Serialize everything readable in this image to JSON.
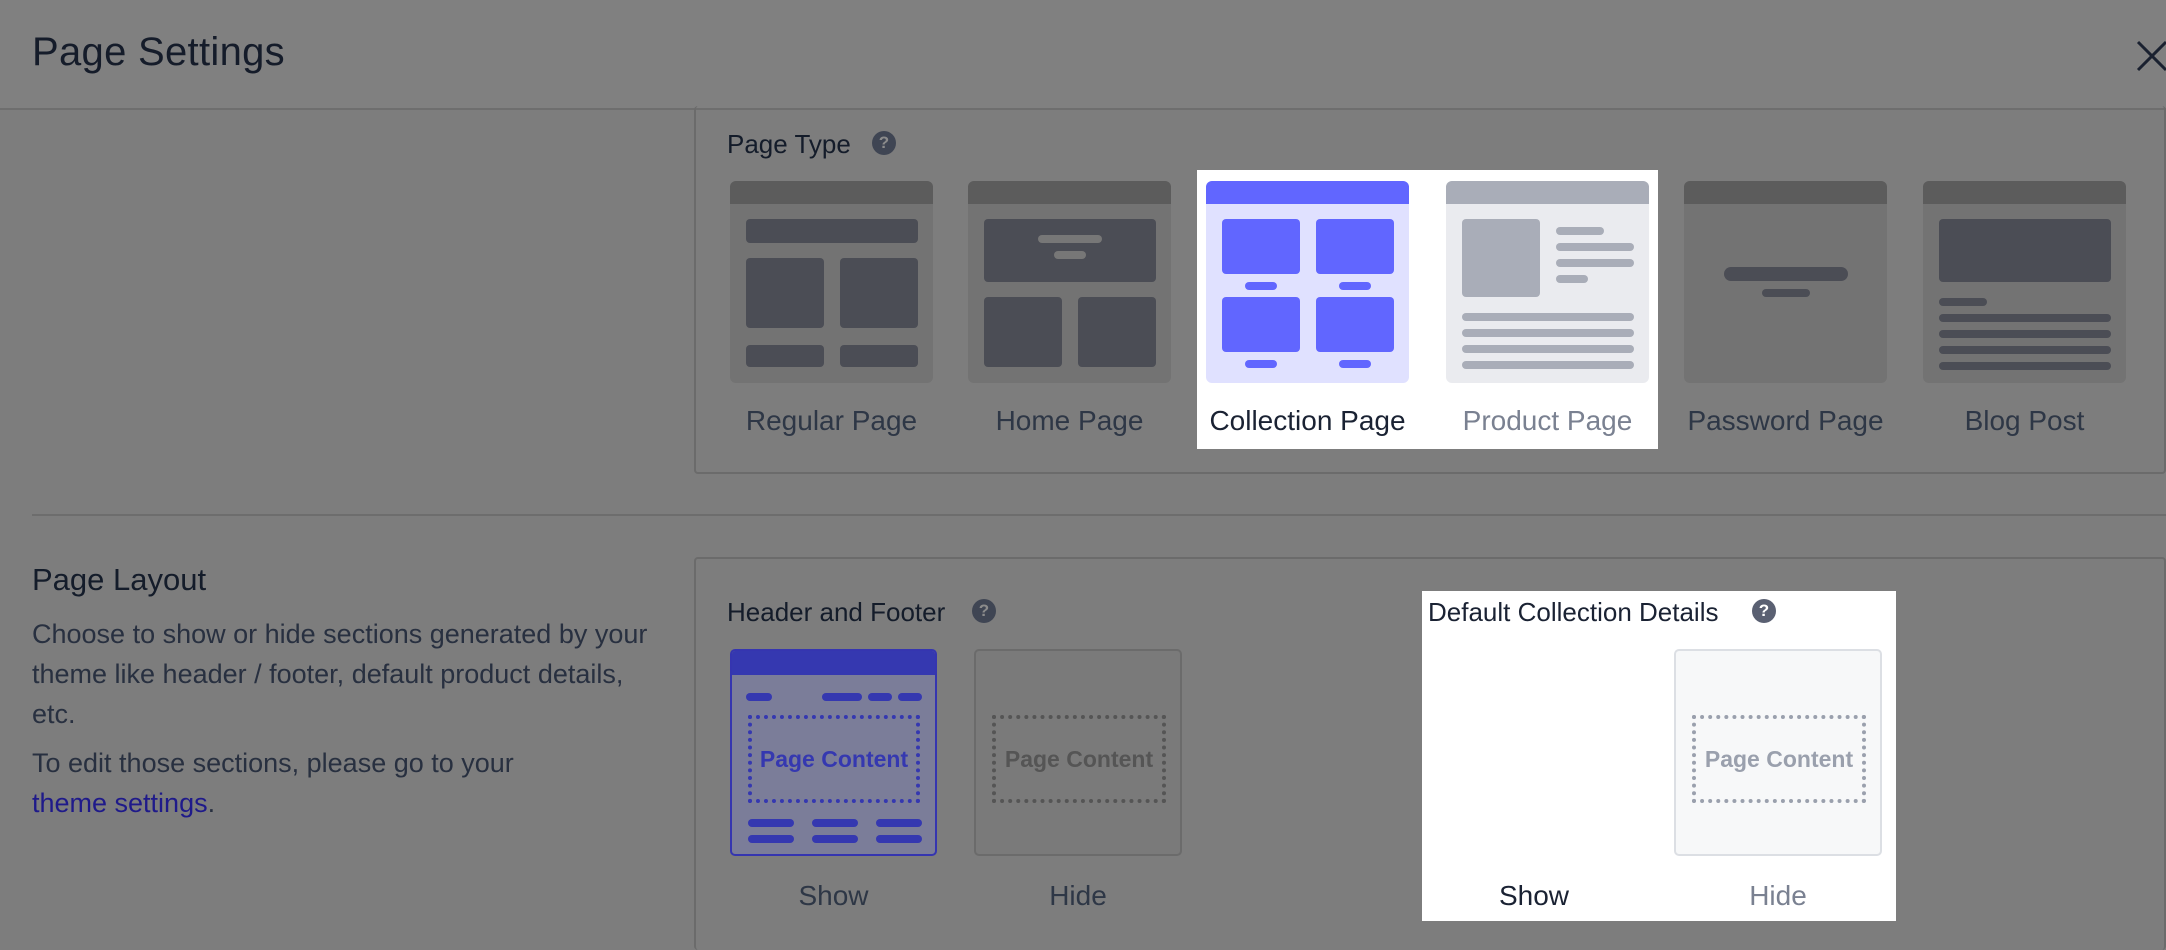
{
  "header": {
    "title": "Page Settings"
  },
  "page_type": {
    "label": "Page Type",
    "help": "?",
    "cards": [
      {
        "label": "Regular Page"
      },
      {
        "label": "Home Page"
      },
      {
        "label": "Collection Page"
      },
      {
        "label": "Product Page"
      },
      {
        "label": "Password Page"
      },
      {
        "label": "Blog Post"
      }
    ]
  },
  "page_layout": {
    "title": "Page Layout",
    "description": "Choose to show or hide sections generated by your theme like header / footer, default product details, etc.",
    "edit_prefix": "To edit those sections, please go to your",
    "link_text": "theme settings",
    "link_suffix": "."
  },
  "header_footer": {
    "label": "Header and Footer",
    "help": "?",
    "show_label": "Show",
    "hide_label": "Hide",
    "content_label": "Page Content"
  },
  "collection_details": {
    "label": "Default Collection Details",
    "help": "?",
    "show_label": "Show",
    "hide_label": "Hide",
    "content_label": "Page Content"
  },
  "colors": {
    "accent": "#6166ff",
    "selected_bg": "#e0e1ff",
    "overlay": "#7d7d7d"
  }
}
